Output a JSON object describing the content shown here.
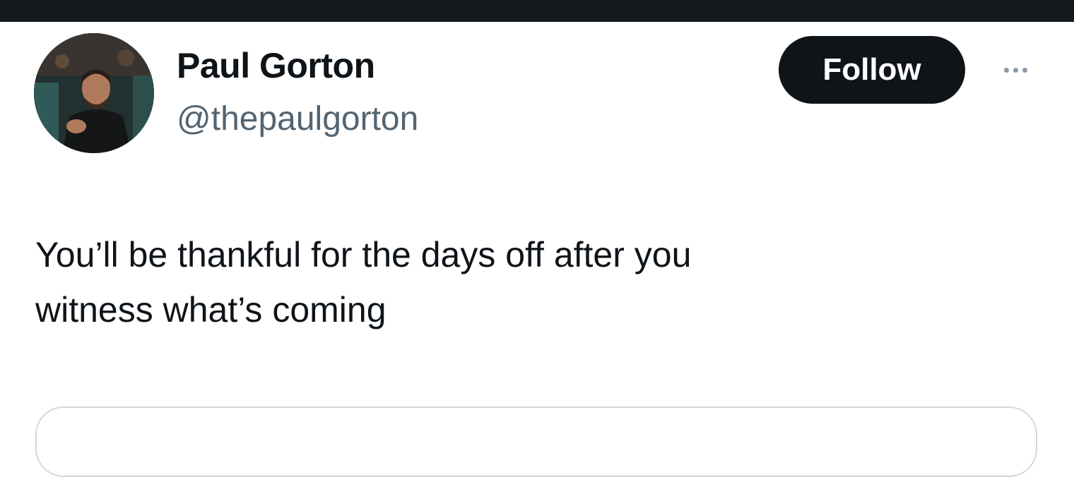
{
  "tweet": {
    "author": {
      "display_name": "Paul Gorton",
      "handle": "@thepaulgorton",
      "avatar_icon": "profile-photo"
    },
    "follow_label": "Follow",
    "more_icon": "ellipsis-icon",
    "text_line1": "You’ll be thankful for the days off after you",
    "text_line2": "witness what’s coming"
  },
  "colors": {
    "top_bar": "#15181c",
    "primary_text": "#0f1419",
    "secondary_text": "#536471",
    "follow_button_bg": "#0f1419",
    "follow_button_text": "#ffffff",
    "card_border": "#cfd9de"
  }
}
